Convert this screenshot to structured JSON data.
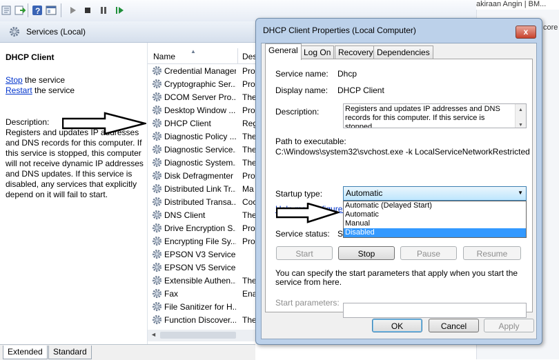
{
  "toolbar": {
    "icons": [
      "back-icon",
      "forward-icon",
      "console-tree-icon",
      "properties-icon",
      "help-icon",
      "mmc-view-icon",
      "play-icon",
      "stop-icon",
      "pause-icon",
      "resume-icon"
    ]
  },
  "background_window": {
    "title_fragment": "akiraan Angin | BM...",
    "side_text": "core"
  },
  "services_pane": {
    "header_title": "Services (Local)",
    "detail": {
      "service_name": "DHCP Client",
      "stop_link": "Stop",
      "stop_suffix": " the service",
      "restart_link": "Restart",
      "restart_suffix": " the service",
      "description_label": "Description:",
      "description": "Registers and updates IP addresses and DNS records for this computer. If this service is stopped, this computer will not receive dynamic IP addresses and DNS updates. If this service is disabled, any services that explicitly depend on it will fail to start."
    },
    "list": {
      "columns": [
        "Name",
        "Des"
      ],
      "rows": [
        {
          "name": "Credential Manager",
          "desc": "Pro"
        },
        {
          "name": "Cryptographic Ser...",
          "desc": "Pro"
        },
        {
          "name": "DCOM Server Pro...",
          "desc": "The"
        },
        {
          "name": "Desktop Window ...",
          "desc": "Pro"
        },
        {
          "name": "DHCP Client",
          "desc": "Reg"
        },
        {
          "name": "Diagnostic Policy ...",
          "desc": "The"
        },
        {
          "name": "Diagnostic Service...",
          "desc": "The"
        },
        {
          "name": "Diagnostic System...",
          "desc": "The"
        },
        {
          "name": "Disk Defragmenter",
          "desc": "Pro"
        },
        {
          "name": "Distributed Link Tr...",
          "desc": "Ma"
        },
        {
          "name": "Distributed Transa...",
          "desc": "Coo"
        },
        {
          "name": "DNS Client",
          "desc": "The"
        },
        {
          "name": "Drive Encryption S...",
          "desc": "Pro"
        },
        {
          "name": "Encrypting File Sy...",
          "desc": "Pro"
        },
        {
          "name": "EPSON V3 Service...",
          "desc": ""
        },
        {
          "name": "EPSON V5 Service...",
          "desc": ""
        },
        {
          "name": "Extensible Authen...",
          "desc": "The"
        },
        {
          "name": "Fax",
          "desc": "Ena"
        },
        {
          "name": "File Sanitizer for H...",
          "desc": ""
        },
        {
          "name": "Function Discover...",
          "desc": "The"
        }
      ]
    },
    "bottom_tabs": [
      "Extended",
      "Standard"
    ]
  },
  "dialog": {
    "title": "DHCP Client Properties (Local Computer)",
    "close": "x",
    "tabs": [
      "General",
      "Log On",
      "Recovery",
      "Dependencies"
    ],
    "service_name_label": "Service name:",
    "service_name": "Dhcp",
    "display_name_label": "Display name:",
    "display_name": "DHCP Client",
    "description_label": "Description:",
    "description": "Registers and updates IP addresses and DNS records for this computer. If this service is stopped,",
    "path_label": "Path to executable:",
    "path": "C:\\Windows\\system32\\svchost.exe -k LocalServiceNetworkRestricted",
    "startup_label": "Startup type:",
    "startup_value": "Automatic",
    "startup_options": [
      "Automatic (Delayed Start)",
      "Automatic",
      "Manual",
      "Disabled"
    ],
    "startup_highlighted": "Disabled",
    "help_link": "Help me configure s",
    "service_status_label": "Service status:",
    "service_status": "Started",
    "buttons": {
      "start": "Start",
      "stop": "Stop",
      "pause": "Pause",
      "resume": "Resume"
    },
    "start_params_note": "You can specify the start parameters that apply when you start the service from here.",
    "start_params_label": "Start parameters:",
    "start_params_value": "",
    "ok": "OK",
    "cancel": "Cancel",
    "apply": "Apply"
  }
}
